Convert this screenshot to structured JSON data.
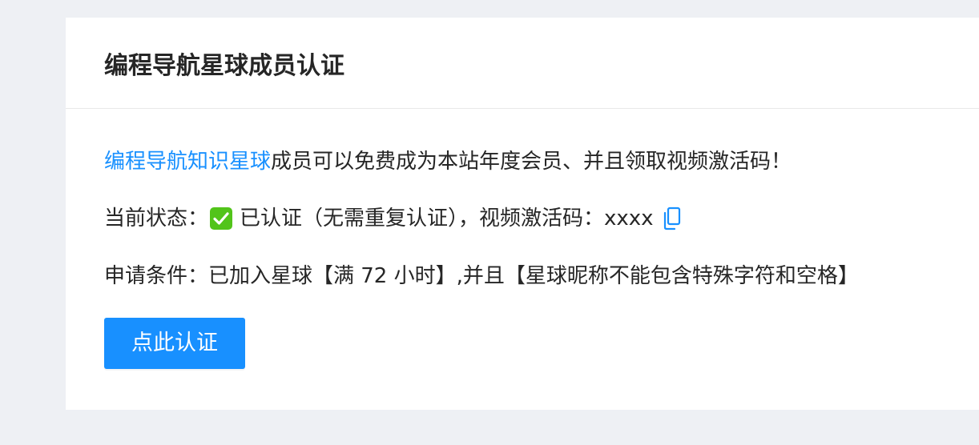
{
  "card": {
    "title": "编程导航星球成员认证"
  },
  "intro": {
    "link_text": "编程导航知识星球",
    "rest_text": "成员可以免费成为本站年度会员、并且领取视频激活码！"
  },
  "status": {
    "label": "当前状态：",
    "value": "已认证（无需重复认证），视频激活码：xxxx"
  },
  "conditions": {
    "text": "申请条件：已加入星球【满 72 小时】,并且【星球昵称不能包含特殊字符和空格】"
  },
  "action": {
    "button_label": "点此认证"
  },
  "colors": {
    "accent": "#1890ff",
    "success": "#52c41a",
    "background": "#eef0f4"
  }
}
